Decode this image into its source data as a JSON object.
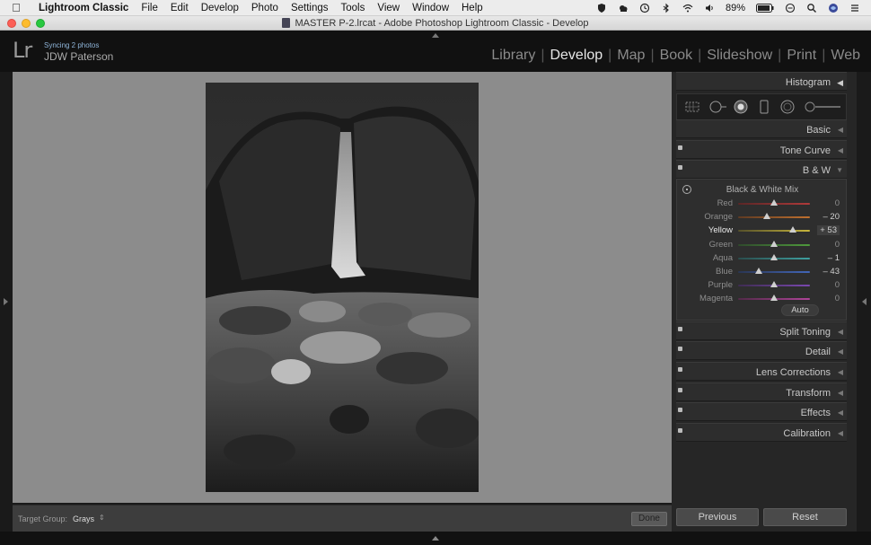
{
  "menubar": {
    "items": [
      "Lightroom Classic",
      "File",
      "Edit",
      "Develop",
      "Photo",
      "Settings",
      "Tools",
      "View",
      "Window",
      "Help"
    ],
    "battery": "89%"
  },
  "window": {
    "title": "MASTER P-2.lrcat - Adobe Photoshop Lightroom Classic - Develop"
  },
  "header": {
    "logo": "Lr",
    "sync_status": "Syncing 2 photos",
    "user_name": "JDW Paterson",
    "modules": [
      {
        "label": "Library",
        "active": false
      },
      {
        "label": "Develop",
        "active": true
      },
      {
        "label": "Map",
        "active": false
      },
      {
        "label": "Book",
        "active": false
      },
      {
        "label": "Slideshow",
        "active": false
      },
      {
        "label": "Print",
        "active": false
      },
      {
        "label": "Web",
        "active": false
      }
    ]
  },
  "toolbar": {
    "target_group_label": "Target Group:",
    "target_group_value": "Grays",
    "done_label": "Done"
  },
  "panels": {
    "histogram": "Histogram",
    "basic": "Basic",
    "tone_curve": "Tone Curve",
    "bw": "B & W",
    "bw_mix_title": "Black & White Mix",
    "sliders": [
      {
        "label": "Red",
        "value": 0,
        "display": "0",
        "color_from": "#5a2626",
        "color_to": "#b03a3a"
      },
      {
        "label": "Orange",
        "value": -20,
        "display": "– 20",
        "color_from": "#5e3a22",
        "color_to": "#c0702e"
      },
      {
        "label": "Yellow",
        "value": 53,
        "display": "+ 53",
        "color_from": "#55502a",
        "color_to": "#c8b63c"
      },
      {
        "label": "Green",
        "value": 0,
        "display": "0",
        "color_from": "#2f4a2c",
        "color_to": "#4f9a3c"
      },
      {
        "label": "Aqua",
        "value": -1,
        "display": "– 1",
        "color_from": "#2a4c4c",
        "color_to": "#3ea0a0"
      },
      {
        "label": "Blue",
        "value": -43,
        "display": "– 43",
        "color_from": "#2a3552",
        "color_to": "#4266b8"
      },
      {
        "label": "Purple",
        "value": 0,
        "display": "0",
        "color_from": "#3e2c52",
        "color_to": "#7a48b0"
      },
      {
        "label": "Magenta",
        "value": 0,
        "display": "0",
        "color_from": "#522a48",
        "color_to": "#b0449a"
      }
    ],
    "auto_label": "Auto",
    "split_toning": "Split Toning",
    "detail": "Detail",
    "lens_corrections": "Lens Corrections",
    "transform": "Transform",
    "effects": "Effects",
    "calibration": "Calibration",
    "previous_label": "Previous",
    "reset_label": "Reset"
  }
}
